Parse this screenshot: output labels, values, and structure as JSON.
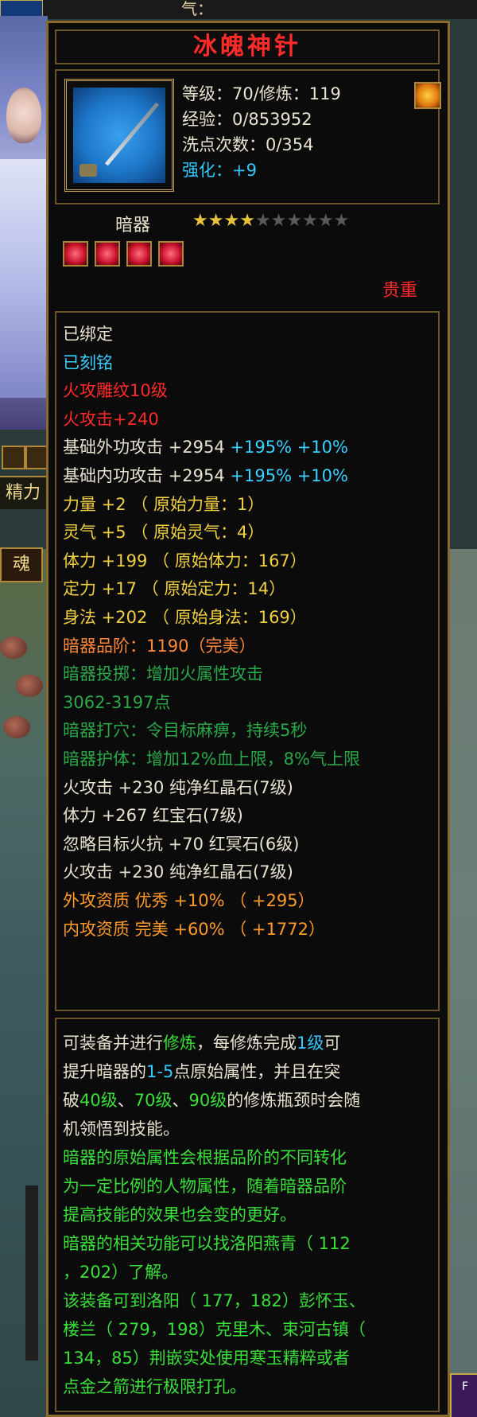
{
  "top_bar": {
    "qi_label": "气："
  },
  "left_ui": {
    "jingli_label": "精力",
    "hun_tab_label": "魂"
  },
  "corner_badge": "F",
  "item": {
    "name": "冰魄神针",
    "level_line": "等级：70/修炼：119",
    "exp_line": "经验：0/853952",
    "wash_line": "洗点次数：0/354",
    "enhance_label": "强化：",
    "enhance_value": "+9",
    "type": "暗器",
    "stars_total": 10,
    "stars_filled": 4,
    "rarity": "贵重"
  },
  "stats": [
    {
      "text": "已绑定",
      "color": "white"
    },
    {
      "text": "已刻铭",
      "color": "blue"
    },
    {
      "text": "火攻雕纹10级",
      "color": "red"
    },
    {
      "text": "火攻击+240",
      "color": "red"
    },
    {
      "text": "基础外功攻击  +2954 ",
      "color": "white",
      "extra": "+195% +10%"
    },
    {
      "text": "基础内功攻击  +2954 ",
      "color": "white",
      "extra": "+195% +10%"
    },
    {
      "text": "力量  +2 （ 原始力量：1）",
      "color": "yellow"
    },
    {
      "text": "灵气  +5 （ 原始灵气：4）",
      "color": "yellow"
    },
    {
      "text": "体力  +199 （ 原始体力：167）",
      "color": "yellow"
    },
    {
      "text": "定力  +17 （ 原始定力：14）",
      "color": "yellow"
    },
    {
      "text": "身法  +202 （ 原始身法：169）",
      "color": "yellow"
    },
    {
      "text": "暗器品阶：1190（完美）",
      "color": "orange"
    },
    {
      "text": "暗器投掷：增加火属性攻击",
      "color": "green"
    },
    {
      "text": "3062-3197点",
      "color": "green"
    },
    {
      "text": "暗器打穴：令目标麻痹，持续5秒",
      "color": "green"
    },
    {
      "text": "暗器护体：增加12%血上限，8%气上限",
      "color": "green"
    },
    {
      "text": "火攻击  +230  纯净红晶石(7级)",
      "color": "white"
    },
    {
      "text": "体力  +267  红宝石(7级)",
      "color": "white"
    },
    {
      "text": "忽略目标火抗  +70  红冥石(6级)",
      "color": "white"
    },
    {
      "text": "火攻击  +230  纯净红晶石(7级)",
      "color": "white"
    },
    {
      "text": "外攻资质    优秀  +10%  （ +295）",
      "color": "amber"
    },
    {
      "text": "内攻资质    完美  +60%  （ +1772）",
      "color": "amber"
    }
  ],
  "description": {
    "p1_a": "可装备并进行",
    "p1_b": "修炼",
    "p1_c": "，每修炼完成",
    "p1_d": "1级",
    "p1_e": "可",
    "p2_a": "提升暗器的",
    "p2_b": "1-5",
    "p2_c": "点原始属性，并且在突",
    "p3_a": "破",
    "p3_b": "40级",
    "p3_c": "、",
    "p3_d": "70级",
    "p3_e": "、",
    "p3_f": "90级",
    "p3_g": "的修炼瓶颈时会随",
    "p4": "机领悟到技能。",
    "p5": "暗器的原始属性会根据品阶的不同转化",
    "p6": "为一定比例的人物属性，随着暗器品阶",
    "p7": "提高技能的效果也会变的更好。",
    "p8": "暗器的相关功能可以找洛阳燕青（ 112",
    "p9": "，202）了解。",
    "p10": "该装备可到洛阳（ 177，182）彭怀玉、",
    "p11": "楼兰（ 279，198）克里木、束河古镇（",
    "p12": "134，85）荆嵌实处使用寒玉精粹或者",
    "p13": "点金之箭进行极限打孔。"
  }
}
